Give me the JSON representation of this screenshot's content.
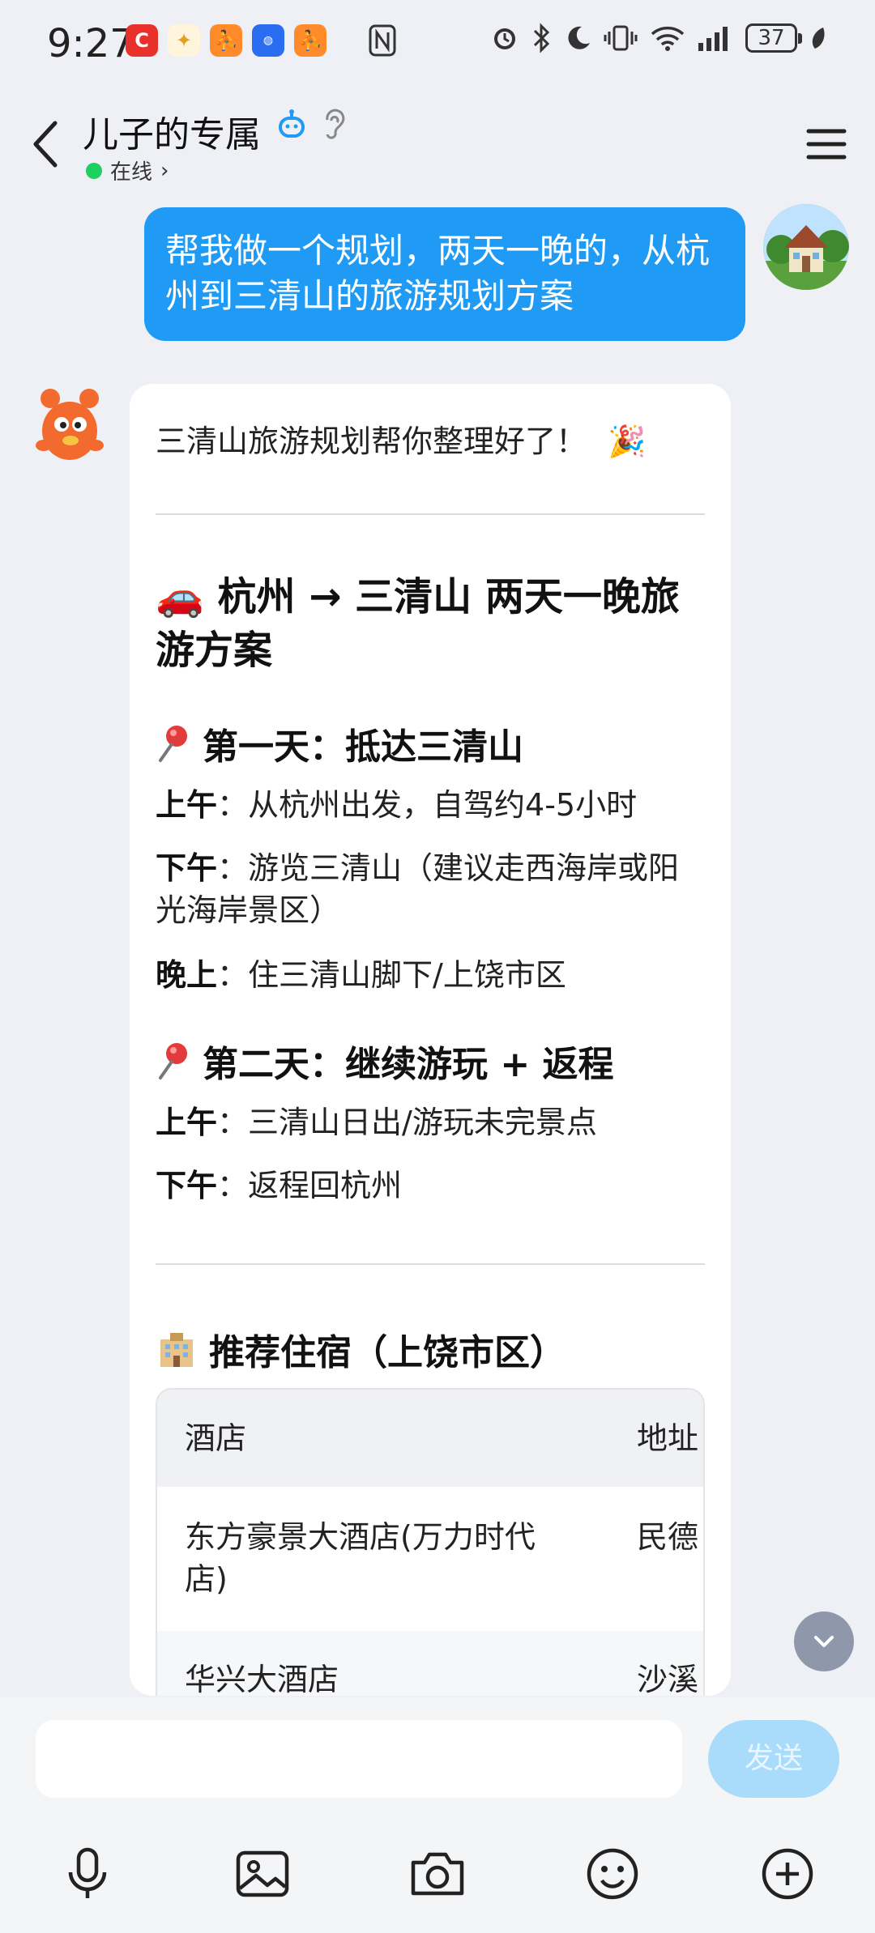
{
  "status_bar": {
    "time": "9:27",
    "battery": "37"
  },
  "header": {
    "title": "儿子的专属",
    "status": "在线",
    "status_chevron": "›"
  },
  "user_message": {
    "text": "帮我做一个规划，两天一晚的，从杭州到三清山的旅游规划方案"
  },
  "bot_message": {
    "intro": "三清山旅游规划帮你整理好了！",
    "intro_emoji": "🎉",
    "plan_title_emoji": "🚗",
    "plan_title": "杭州 → 三清山 两天一晚旅游方案",
    "day1": {
      "title": "第一天：抵达三清山",
      "rows": [
        {
          "label": "上午",
          "text": "：从杭州出发，自驾约4-5小时"
        },
        {
          "label": "下午",
          "text": "：游览三清山（建议走西海岸或阳光海岸景区）"
        },
        {
          "label": "晚上",
          "text": "：住三清山脚下/上饶市区"
        }
      ]
    },
    "day2": {
      "title": "第二天：继续游玩 + 返程",
      "rows": [
        {
          "label": "上午",
          "text": "：三清山日出/游玩未完景点"
        },
        {
          "label": "下午",
          "text": "：返程回杭州"
        }
      ]
    },
    "hotel_section": {
      "title": "推荐住宿（上饶市区）",
      "columns": [
        "酒店",
        "地址"
      ],
      "rows": [
        [
          "东方豪景大酒店(万力时代店)",
          "民德"
        ],
        [
          "华兴大酒店",
          "沙溪"
        ]
      ]
    }
  },
  "composer": {
    "placeholder": "",
    "send_label": "发送"
  },
  "colors": {
    "user_bubble": "#1f9bf5",
    "online": "#1fcf5f",
    "send_disabled": "#a9dcfb"
  }
}
